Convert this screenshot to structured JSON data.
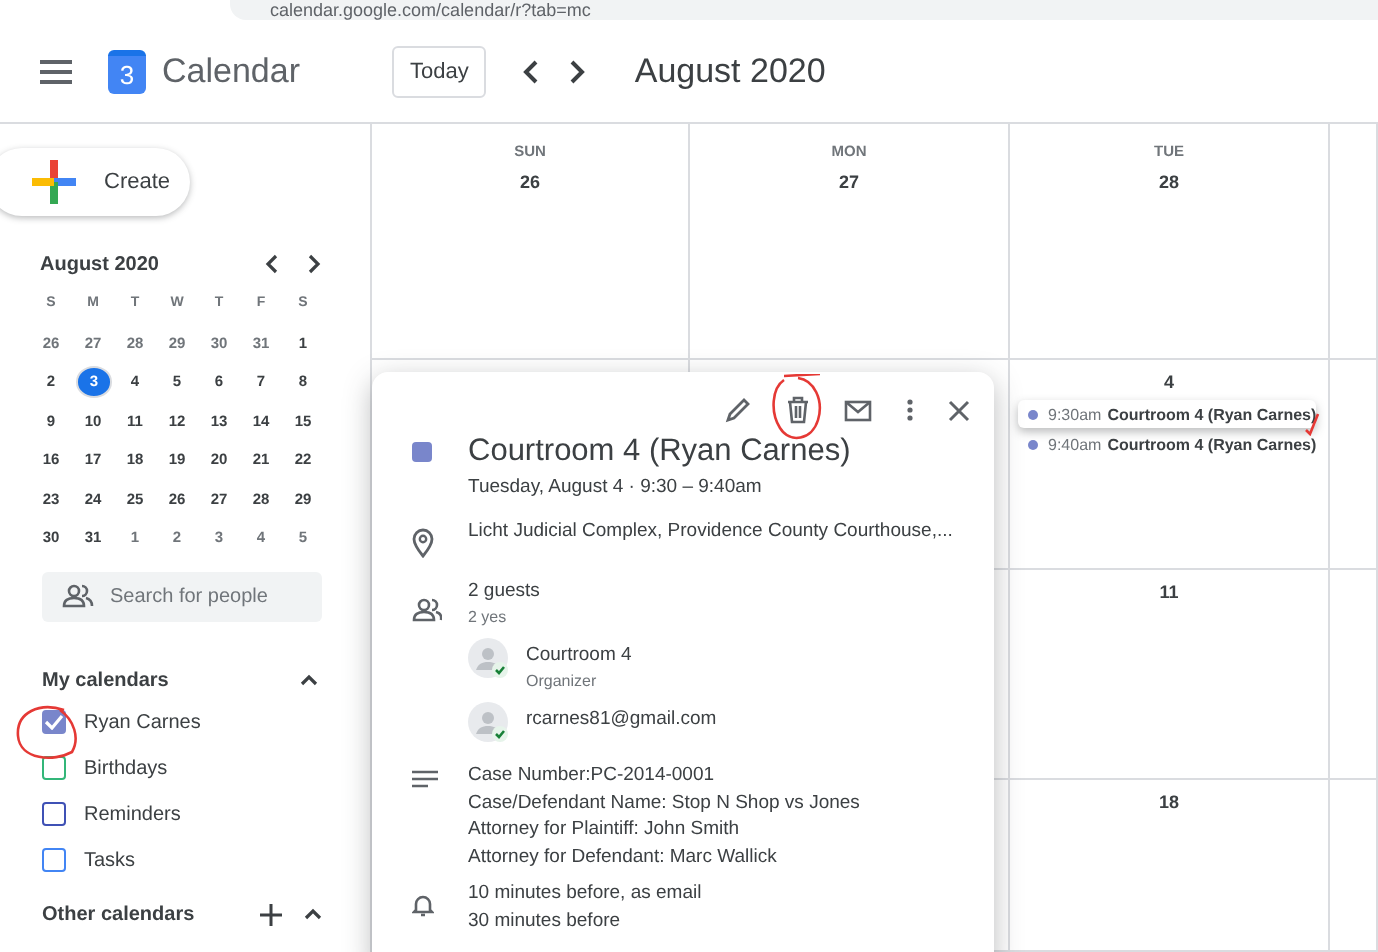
{
  "browser": {
    "url": "calendar.google.com/calendar/r?tab=mc"
  },
  "header": {
    "app_name": "Calendar",
    "logo_day": "3",
    "today_button": "Today",
    "title": "August 2020"
  },
  "sidebar": {
    "create_button": "Create",
    "mini_calendar": {
      "title": "August 2020",
      "weekdays": [
        "S",
        "M",
        "T",
        "W",
        "T",
        "F",
        "S"
      ],
      "weeks": [
        [
          {
            "day": "26",
            "outside": true,
            "today": false
          },
          {
            "day": "27",
            "outside": true,
            "today": false
          },
          {
            "day": "28",
            "outside": true,
            "today": false
          },
          {
            "day": "29",
            "outside": true,
            "today": false
          },
          {
            "day": "30",
            "outside": true,
            "today": false
          },
          {
            "day": "31",
            "outside": true,
            "today": false
          },
          {
            "day": "1",
            "outside": false,
            "today": false
          }
        ],
        [
          {
            "day": "2",
            "outside": false,
            "today": false
          },
          {
            "day": "3",
            "outside": false,
            "today": true
          },
          {
            "day": "4",
            "outside": false,
            "today": false
          },
          {
            "day": "5",
            "outside": false,
            "today": false
          },
          {
            "day": "6",
            "outside": false,
            "today": false
          },
          {
            "day": "7",
            "outside": false,
            "today": false
          },
          {
            "day": "8",
            "outside": false,
            "today": false
          }
        ],
        [
          {
            "day": "9",
            "outside": false,
            "today": false
          },
          {
            "day": "10",
            "outside": false,
            "today": false
          },
          {
            "day": "11",
            "outside": false,
            "today": false
          },
          {
            "day": "12",
            "outside": false,
            "today": false
          },
          {
            "day": "13",
            "outside": false,
            "today": false
          },
          {
            "day": "14",
            "outside": false,
            "today": false
          },
          {
            "day": "15",
            "outside": false,
            "today": false
          }
        ],
        [
          {
            "day": "16",
            "outside": false,
            "today": false
          },
          {
            "day": "17",
            "outside": false,
            "today": false
          },
          {
            "day": "18",
            "outside": false,
            "today": false
          },
          {
            "day": "19",
            "outside": false,
            "today": false
          },
          {
            "day": "20",
            "outside": false,
            "today": false
          },
          {
            "day": "21",
            "outside": false,
            "today": false
          },
          {
            "day": "22",
            "outside": false,
            "today": false
          }
        ],
        [
          {
            "day": "23",
            "outside": false,
            "today": false
          },
          {
            "day": "24",
            "outside": false,
            "today": false
          },
          {
            "day": "25",
            "outside": false,
            "today": false
          },
          {
            "day": "26",
            "outside": false,
            "today": false
          },
          {
            "day": "27",
            "outside": false,
            "today": false
          },
          {
            "day": "28",
            "outside": false,
            "today": false
          },
          {
            "day": "29",
            "outside": false,
            "today": false
          }
        ],
        [
          {
            "day": "30",
            "outside": false,
            "today": false
          },
          {
            "day": "31",
            "outside": false,
            "today": false
          },
          {
            "day": "1",
            "outside": true,
            "today": false
          },
          {
            "day": "2",
            "outside": true,
            "today": false
          },
          {
            "day": "3",
            "outside": true,
            "today": false
          },
          {
            "day": "4",
            "outside": true,
            "today": false
          },
          {
            "day": "5",
            "outside": true,
            "today": false
          }
        ]
      ]
    },
    "search": {
      "placeholder": "Search for people"
    },
    "my_calendars": {
      "title": "My calendars",
      "items": [
        {
          "label": "Ryan Carnes",
          "checked": true,
          "color": "#7986cb"
        },
        {
          "label": "Birthdays",
          "checked": false,
          "color": "#33b679"
        },
        {
          "label": "Reminders",
          "checked": false,
          "color": "#3f51b5"
        },
        {
          "label": "Tasks",
          "checked": false,
          "color": "#4285f4"
        }
      ]
    },
    "other_calendars": {
      "title": "Other calendars"
    }
  },
  "month": {
    "day_headers": [
      {
        "name": "SUN",
        "date": "26"
      },
      {
        "name": "MON",
        "date": "27"
      },
      {
        "name": "TUE",
        "date": "28"
      }
    ],
    "tuesday_cells": [
      {
        "date": "4",
        "events": [
          {
            "time": "9:30am",
            "title": "Courtroom 4 (Ryan Carnes)",
            "selected": true,
            "color": "#7986cb"
          },
          {
            "time": "9:40am",
            "title": "Courtroom 4 (Ryan Carnes)",
            "selected": false,
            "color": "#7986cb"
          }
        ]
      },
      {
        "date": "11"
      },
      {
        "date": "18"
      }
    ]
  },
  "event_popup": {
    "color": "#7986cb",
    "title": "Courtroom 4 (Ryan Carnes)",
    "when": "Tuesday, August 4  ·  9:30 – 9:40am",
    "location": "Licht Judicial Complex, Providence County Courthouse,...",
    "guests_count": "2 guests",
    "guests_summary": "2 yes",
    "guests": [
      {
        "name": "Courtroom 4",
        "role": "Organizer"
      },
      {
        "name": "rcarnes81@gmail.com"
      }
    ],
    "description": [
      "Case Number:PC-2014-0001",
      "Case/Defendant Name: Stop N Shop vs Jones",
      "Attorney for Plaintiff: John Smith",
      "Attorney for Defendant: Marc Wallick"
    ],
    "reminders": [
      "10 minutes before, as email",
      "30 minutes before"
    ]
  }
}
